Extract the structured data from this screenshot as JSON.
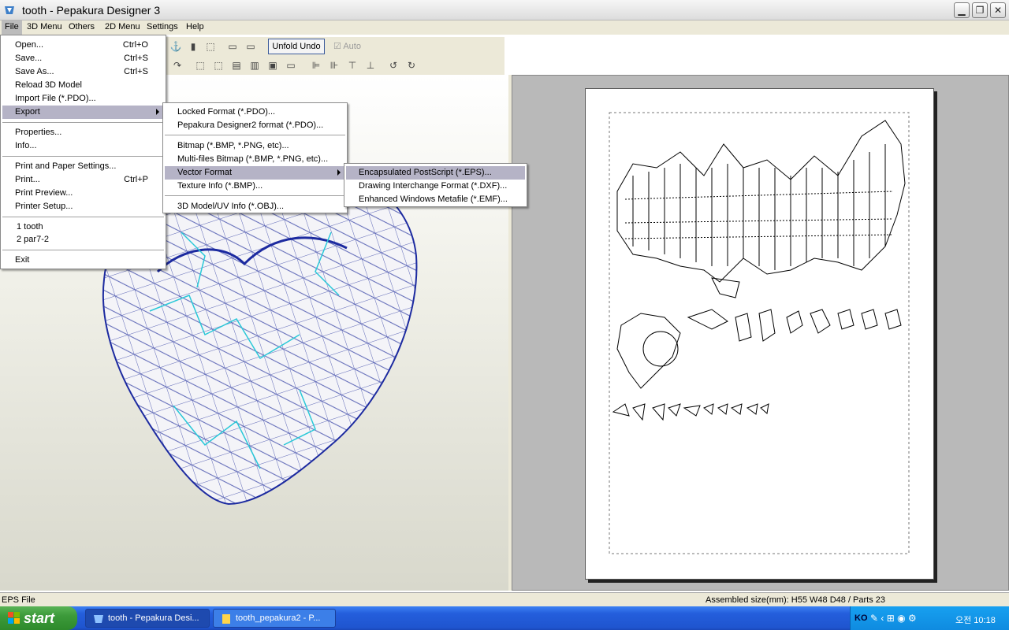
{
  "window": {
    "title": "tooth - Pepakura Designer 3"
  },
  "menubar": {
    "items": [
      "File",
      "3D Menu",
      "Others",
      "2D Menu",
      "Settings",
      "Help"
    ]
  },
  "toolbar": {
    "unfold_undo": "Unfold Undo",
    "auto": "Auto"
  },
  "file_menu": {
    "open": "Open...",
    "open_sc": "Ctrl+O",
    "save": "Save...",
    "save_sc": "Ctrl+S",
    "save_as": "Save As...",
    "save_as_sc": "Ctrl+S",
    "reload": "Reload 3D Model",
    "import": "Import File (*.PDO)...",
    "export": "Export",
    "properties": "Properties...",
    "info": "Info...",
    "print_paper": "Print and Paper Settings...",
    "print": "Print...",
    "print_sc": "Ctrl+P",
    "print_preview": "Print Preview...",
    "printer_setup": "Printer Setup...",
    "recent1": "1 tooth",
    "recent2": "2 par7-2",
    "exit": "Exit"
  },
  "export_menu": {
    "locked": "Locked Format (*.PDO)...",
    "pd2": "Pepakura Designer2 format (*.PDO)...",
    "bitmap": "Bitmap (*.BMP, *.PNG, etc)...",
    "multi_bitmap": "Multi-files Bitmap (*.BMP, *.PNG, etc)...",
    "vector": "Vector Format",
    "texture": "Texture Info (*.BMP)...",
    "obj": "3D Model/UV Info (*.OBJ)..."
  },
  "vector_menu": {
    "eps": "Encapsulated PostScript (*.EPS)...",
    "dxf": "Drawing Interchange Format (*.DXF)...",
    "emf": "Enhanced Windows Metafile (*.EMF)..."
  },
  "status": {
    "left": "EPS File",
    "right": "Assembled size(mm): H55 W48 D48 / Parts 23"
  },
  "taskbar": {
    "start": "start",
    "task1": "tooth - Pepakura Desi...",
    "task2": "tooth_pepakura2 - P...",
    "lang": "KO",
    "clock": "오전 10:18"
  }
}
